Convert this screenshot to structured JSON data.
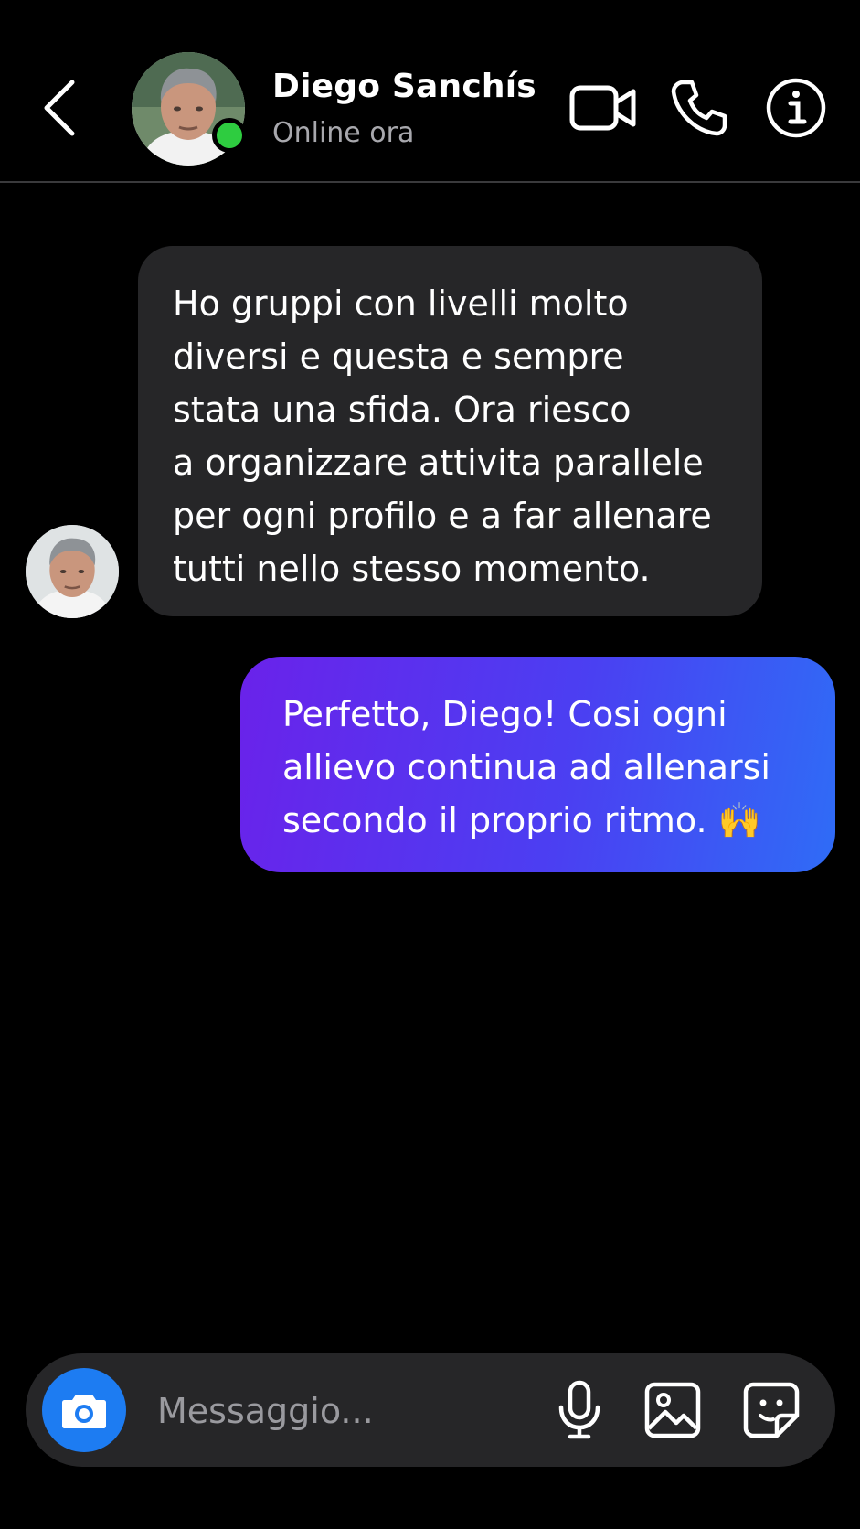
{
  "header": {
    "contact_name": "Diego Sanchís",
    "status": "Online ora",
    "icons": [
      "back-icon",
      "video-call-icon",
      "phone-icon",
      "info-icon"
    ]
  },
  "messages": [
    {
      "direction": "incoming",
      "text": "Ho gruppi con livelli molto\ndiversi e questa e sempre\nstata una sfida. Ora riesco\na organizzare attivita parallele\nper ogni profilo e a far allenare\ntutti nello stesso momento."
    },
    {
      "direction": "outgoing",
      "text": "Perfetto, Diego! Cosi ogni\nallievo continua ad allenarsi\nsecondo il proprio ritmo. 🙌"
    }
  ],
  "composer": {
    "placeholder": "Messaggio...",
    "icons": [
      "camera-icon",
      "microphone-icon",
      "gallery-icon",
      "sticker-icon"
    ]
  },
  "colors": {
    "background": "#000000",
    "incoming_bubble": "#262628",
    "outgoing_gradient_start": "#6a22ea",
    "outgoing_gradient_end": "#2f6cf6",
    "online": "#2ecc40",
    "camera_button": "#1d7cf2"
  }
}
